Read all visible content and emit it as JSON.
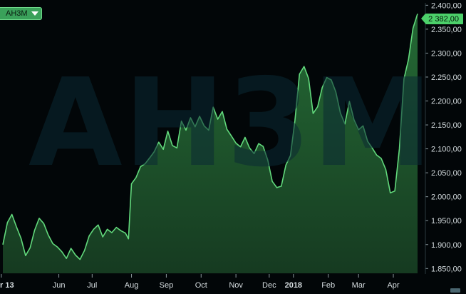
{
  "ticker": {
    "label": "AH3M",
    "dropdown_icon": "chevron-down-icon"
  },
  "watermark": "AH3M",
  "last_price_label": "2 382,00",
  "colors": {
    "background": "#020608",
    "line": "#62d97c",
    "fill": "#1f5a2c",
    "text": "#d6dde0",
    "badge": "#3aa15a"
  },
  "chart_data": {
    "type": "area",
    "title": "",
    "xlabel": "",
    "ylabel": "",
    "ylim": [
      1840,
      2405
    ],
    "y_ticks": [
      1850,
      1900,
      1950,
      2000,
      2050,
      2100,
      2150,
      2200,
      2250,
      2300,
      2350,
      2400
    ],
    "y_tick_labels": [
      "1.850,00",
      "1.900,00",
      "1.950,00",
      "2.000,00",
      "2.050,00",
      "2.100,00",
      "2.150,00",
      "2.200,00",
      "2.250,00",
      "2.300,00",
      "2.350,00",
      "2.400,00"
    ],
    "x_tick_labels": [
      {
        "label": "r 13",
        "bold": true,
        "t": 0
      },
      {
        "label": "Jun",
        "bold": false,
        "t": 38
      },
      {
        "label": "Jul",
        "bold": false,
        "t": 60
      },
      {
        "label": "Aug",
        "bold": false,
        "t": 86
      },
      {
        "label": "Sep",
        "bold": false,
        "t": 109
      },
      {
        "label": "Oct",
        "bold": false,
        "t": 132
      },
      {
        "label": "Nov",
        "bold": false,
        "t": 155
      },
      {
        "label": "Dec",
        "bold": false,
        "t": 177
      },
      {
        "label": "2018",
        "bold": true,
        "t": 193
      },
      {
        "label": "Feb",
        "bold": false,
        "t": 216
      },
      {
        "label": "Mar",
        "bold": false,
        "t": 236
      },
      {
        "label": "Apr",
        "bold": false,
        "t": 259
      }
    ],
    "x_range": [
      1,
      275
    ],
    "series": [
      {
        "values": [
          [
            1,
            1900
          ],
          [
            4,
            1946
          ],
          [
            7,
            1963
          ],
          [
            10,
            1937
          ],
          [
            13,
            1913
          ],
          [
            16,
            1877
          ],
          [
            19,
            1893
          ],
          [
            22,
            1930
          ],
          [
            25,
            1955
          ],
          [
            28,
            1944
          ],
          [
            31,
            1920
          ],
          [
            34,
            1902
          ],
          [
            37,
            1895
          ],
          [
            40,
            1885
          ],
          [
            43,
            1871
          ],
          [
            46,
            1892
          ],
          [
            49,
            1878
          ],
          [
            52,
            1869
          ],
          [
            55,
            1888
          ],
          [
            58,
            1918
          ],
          [
            61,
            1932
          ],
          [
            64,
            1941
          ],
          [
            67,
            1916
          ],
          [
            70,
            1932
          ],
          [
            73,
            1925
          ],
          [
            76,
            1936
          ],
          [
            79,
            1929
          ],
          [
            82,
            1924
          ],
          [
            84,
            1912
          ],
          [
            86,
            2027
          ],
          [
            89,
            2040
          ],
          [
            92,
            2063
          ],
          [
            95,
            2069
          ],
          [
            98,
            2081
          ],
          [
            101,
            2094
          ],
          [
            104,
            2114
          ],
          [
            107,
            2099
          ],
          [
            110,
            2137
          ],
          [
            113,
            2107
          ],
          [
            116,
            2102
          ],
          [
            119,
            2158
          ],
          [
            122,
            2139
          ],
          [
            125,
            2165
          ],
          [
            128,
            2146
          ],
          [
            131,
            2168
          ],
          [
            134,
            2148
          ],
          [
            137,
            2139
          ],
          [
            140,
            2187
          ],
          [
            143,
            2162
          ],
          [
            146,
            2178
          ],
          [
            149,
            2141
          ],
          [
            152,
            2127
          ],
          [
            155,
            2112
          ],
          [
            158,
            2104
          ],
          [
            161,
            2124
          ],
          [
            164,
            2102
          ],
          [
            167,
            2090
          ],
          [
            170,
            2111
          ],
          [
            173,
            2105
          ],
          [
            176,
            2077
          ],
          [
            179,
            2032
          ],
          [
            182,
            2019
          ],
          [
            185,
            2022
          ],
          [
            188,
            2066
          ],
          [
            191,
            2086
          ],
          [
            194,
            2159
          ],
          [
            197,
            2256
          ],
          [
            200,
            2272
          ],
          [
            203,
            2247
          ],
          [
            206,
            2174
          ],
          [
            209,
            2188
          ],
          [
            212,
            2228
          ],
          [
            215,
            2249
          ],
          [
            218,
            2244
          ],
          [
            221,
            2219
          ],
          [
            224,
            2175
          ],
          [
            227,
            2152
          ],
          [
            230,
            2199
          ],
          [
            233,
            2161
          ],
          [
            236,
            2140
          ],
          [
            239,
            2148
          ],
          [
            242,
            2116
          ],
          [
            245,
            2102
          ],
          [
            248,
            2087
          ],
          [
            251,
            2080
          ],
          [
            254,
            2057
          ],
          [
            257,
            2008
          ],
          [
            260,
            2012
          ],
          [
            263,
            2100
          ],
          [
            266,
            2246
          ],
          [
            269,
            2287
          ],
          [
            272,
            2352
          ],
          [
            275,
            2382
          ]
        ]
      }
    ]
  }
}
